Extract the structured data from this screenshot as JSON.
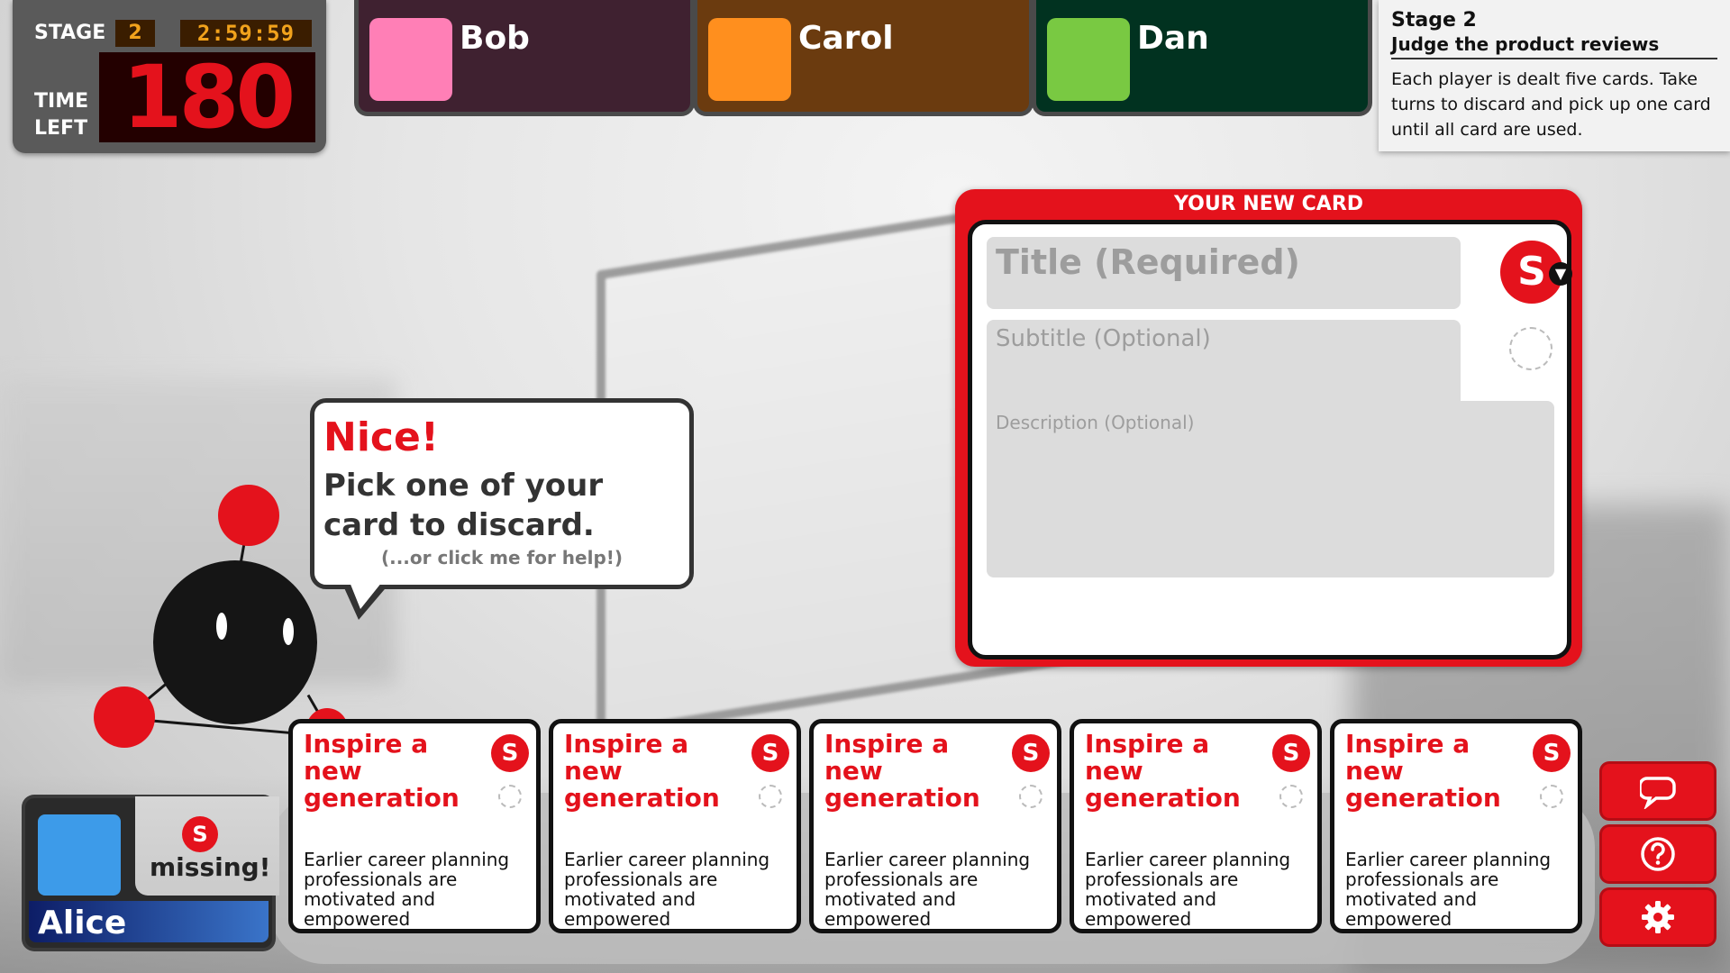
{
  "timer": {
    "stage_label": "STAGE",
    "stage_number": "2",
    "clock": "2:59:59",
    "time_left_label_1": "TIME",
    "time_left_label_2": "LEFT",
    "seconds_left": "180"
  },
  "players": [
    {
      "name": "Bob",
      "color": "#ff7fb6",
      "panel_color": "#3f2130"
    },
    {
      "name": "Carol",
      "color": "#ff8f1e",
      "panel_color": "#6b3b0f"
    },
    {
      "name": "Dan",
      "color": "#79c942",
      "panel_color": "#013220"
    }
  ],
  "stage_info": {
    "title": "Stage 2",
    "subtitle": "Judge the product reviews",
    "description": "Each player is dealt five cards. Take turns to discard and pick up one card until all card are used."
  },
  "new_card": {
    "header": "YOUR NEW CARD",
    "title_placeholder": "Title (Required)",
    "subtitle_placeholder": "Subtitle (Optional)",
    "description_placeholder": "Description (Optional)",
    "badge": "S"
  },
  "bubble": {
    "exclaim": "Nice!",
    "message": "Pick one of your card to discard.",
    "help": "(...or click me for help!)"
  },
  "hand": [
    {
      "title": "Inspire a new generation",
      "badge": "S",
      "description": "Earlier career planning professionals are motivated and empowered"
    },
    {
      "title": "Inspire a new generation",
      "badge": "S",
      "description": "Earlier career planning professionals are motivated and empowered"
    },
    {
      "title": "Inspire a new generation",
      "badge": "S",
      "description": "Earlier career planning professionals are motivated and empowered"
    },
    {
      "title": "Inspire a new generation",
      "badge": "S",
      "description": "Earlier career planning professionals are motivated and empowered"
    },
    {
      "title": "Inspire a new generation",
      "badge": "S",
      "description": "Earlier career planning professionals are motivated and empowered"
    }
  ],
  "self": {
    "name": "Alice",
    "color": "#3d9be9",
    "missing_badge": "S",
    "missing_text": "missing!"
  },
  "side_buttons": [
    {
      "icon": "chat-icon"
    },
    {
      "icon": "help-icon"
    },
    {
      "icon": "gear-icon"
    }
  ],
  "colors": {
    "accent": "#e4121c"
  }
}
